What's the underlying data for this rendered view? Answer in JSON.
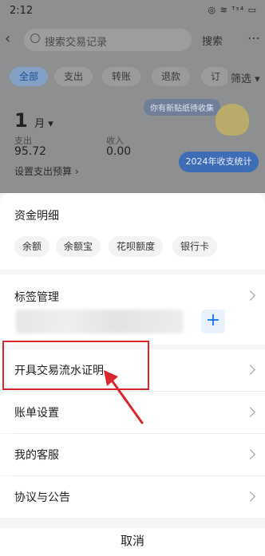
{
  "status_bar": {
    "time": "2:12",
    "icons": "◎ ≋ ᵀˢ⁴ ▭"
  },
  "header": {
    "search_placeholder": "搜索交易记录",
    "search_button": "搜索"
  },
  "filters": {
    "tabs": [
      "全部",
      "支出",
      "转账",
      "退款",
      "订"
    ],
    "filter_label": "筛选"
  },
  "summary": {
    "month": "1",
    "month_unit": "月",
    "expense_label": "支出",
    "expense_value": "95.72",
    "income_label": "收入",
    "income_value": "0.00",
    "budget_link": "设置支出预算",
    "sticker_tip": "你有新贴纸待收集",
    "year_button": "2024年收支统计"
  },
  "sheet": {
    "funds": {
      "title": "资金明细",
      "items": [
        "余额",
        "余额宝",
        "花呗额度",
        "银行卡"
      ]
    },
    "tags": {
      "title": "标签管理",
      "add_label": "+"
    },
    "rows": [
      "开具交易流水证明",
      "账单设置",
      "我的客服",
      "协议与公告"
    ],
    "cancel": "取消"
  },
  "colors": {
    "accent": "#1677ff",
    "highlight": "#d8262c"
  }
}
